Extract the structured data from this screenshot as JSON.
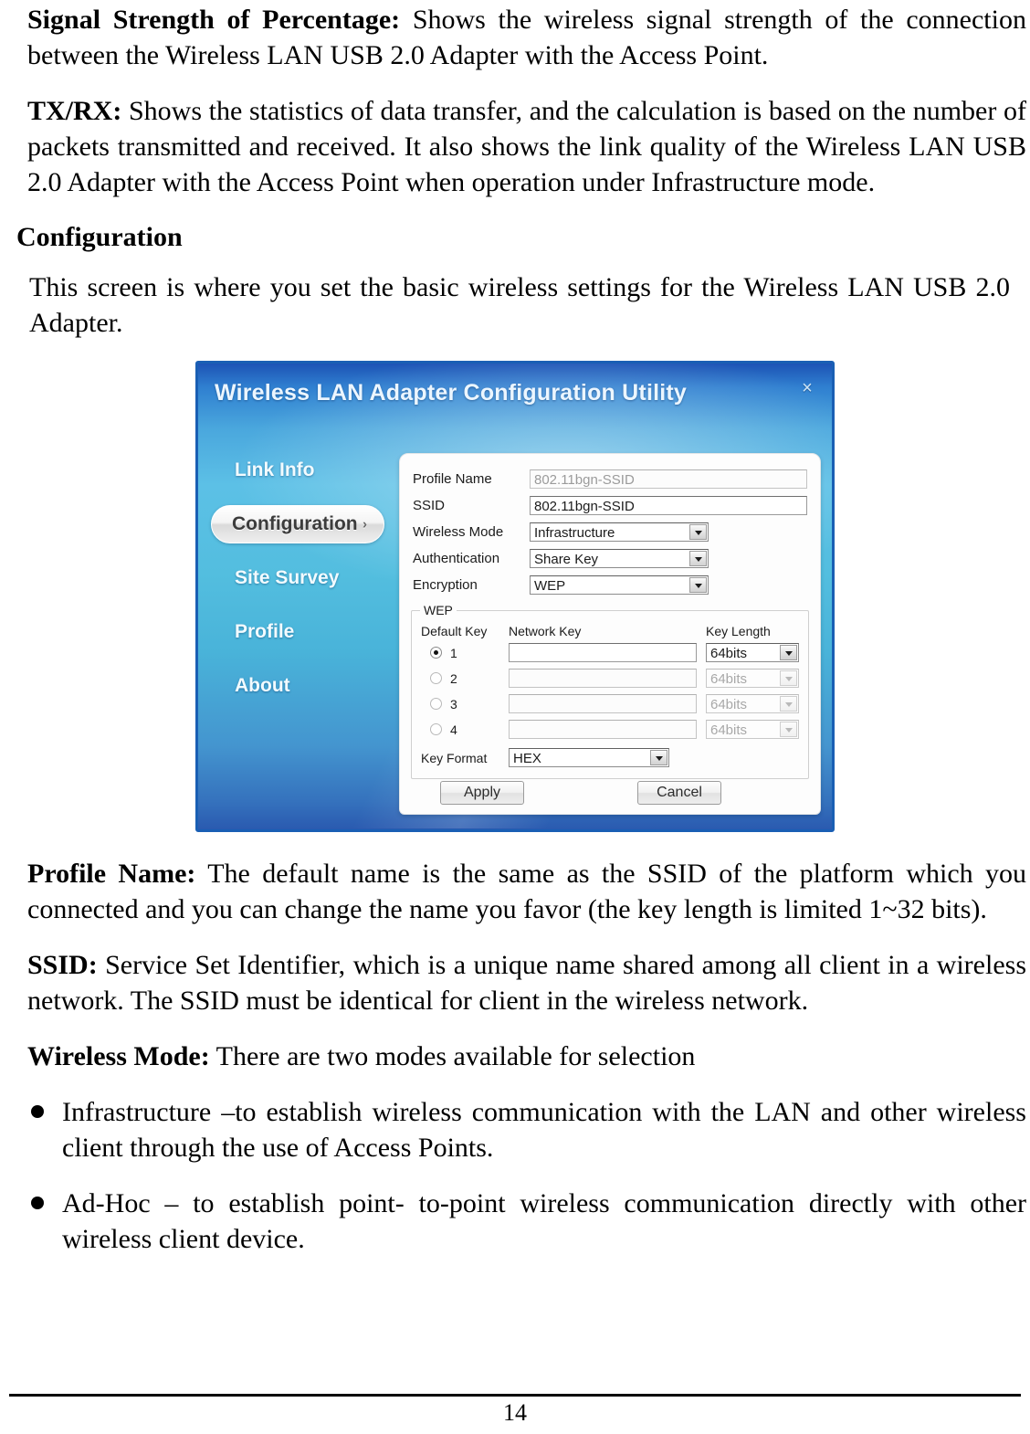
{
  "document": {
    "paragraphs": [
      {
        "id": "signal-strength",
        "lead": "Signal Strength of Percentage:",
        "text": " Shows the wireless signal strength of the connection between the Wireless LAN USB 2.0 Adapter with the Access Point."
      },
      {
        "id": "tx-rx",
        "lead": "TX/RX:",
        "text": " Shows the statistics of data transfer, and the calculation is based on the number of packets transmitted and received. It also shows the link quality of the Wireless LAN USB 2.0 Adapter with the Access Point when operation under Infrastructure mode."
      }
    ],
    "heading": "Configuration",
    "intro": "This screen is where you set the basic wireless settings for the Wireless LAN USB 2.0 Adapter.",
    "after_figure": [
      {
        "id": "profile-name",
        "lead": "Profile Name:",
        "text": " The default name is the same as the SSID of the platform which you connected and you can change the name you favor (the key length is limited 1~32 bits)."
      },
      {
        "id": "ssid",
        "lead": "SSID:",
        "text": " Service Set Identifier, which is a unique name shared among all client in a wireless network. The SSID must be identical for client in the wireless network."
      },
      {
        "id": "wireless-mode",
        "lead": "Wireless Mode:",
        "text": " There are two modes available for selection"
      }
    ],
    "bullets": [
      "Infrastructure –to establish wireless communication with the LAN and other wireless client through the use of Access Points.",
      "Ad-Hoc – to establish point- to-point wireless communication directly with other wireless client device."
    ],
    "footer": {
      "page_number": "14"
    }
  },
  "figure": {
    "window": {
      "title": "Wireless LAN Adapter Configuration Utility",
      "close_label": "×",
      "accent_color": "#4aa7dd",
      "border_color": "#1a5fb4"
    },
    "nav": {
      "items": [
        {
          "label": "Link Info",
          "active": false
        },
        {
          "label": "Configuration",
          "active": true,
          "arrow": "›"
        },
        {
          "label": "Site Survey",
          "active": false
        },
        {
          "label": "Profile",
          "active": false
        },
        {
          "label": "About",
          "active": false
        }
      ]
    },
    "form": {
      "profile_name": {
        "label": "Profile Name",
        "value": "802.11bgn-SSID",
        "readonly": true
      },
      "ssid": {
        "label": "SSID",
        "value": "802.11bgn-SSID",
        "readonly": false
      },
      "wireless_mode": {
        "label": "Wireless Mode",
        "value": "Infrastructure"
      },
      "authentication": {
        "label": "Authentication",
        "value": "Share Key"
      },
      "encryption": {
        "label": "Encryption",
        "value": "WEP"
      }
    },
    "wep": {
      "legend": "WEP",
      "headers": {
        "default_key": "Default Key",
        "network_key": "Network Key",
        "key_length": "Key Length"
      },
      "rows": [
        {
          "index": "1",
          "selected": true,
          "network_key": "",
          "key_length": "64bits",
          "enabled": true
        },
        {
          "index": "2",
          "selected": false,
          "network_key": "",
          "key_length": "64bits",
          "enabled": false
        },
        {
          "index": "3",
          "selected": false,
          "network_key": "",
          "key_length": "64bits",
          "enabled": false
        },
        {
          "index": "4",
          "selected": false,
          "network_key": "",
          "key_length": "64bits",
          "enabled": false
        }
      ],
      "key_format": {
        "label": "Key Format",
        "value": "HEX"
      }
    },
    "actions": {
      "apply": "Apply",
      "cancel": "Cancel"
    }
  }
}
